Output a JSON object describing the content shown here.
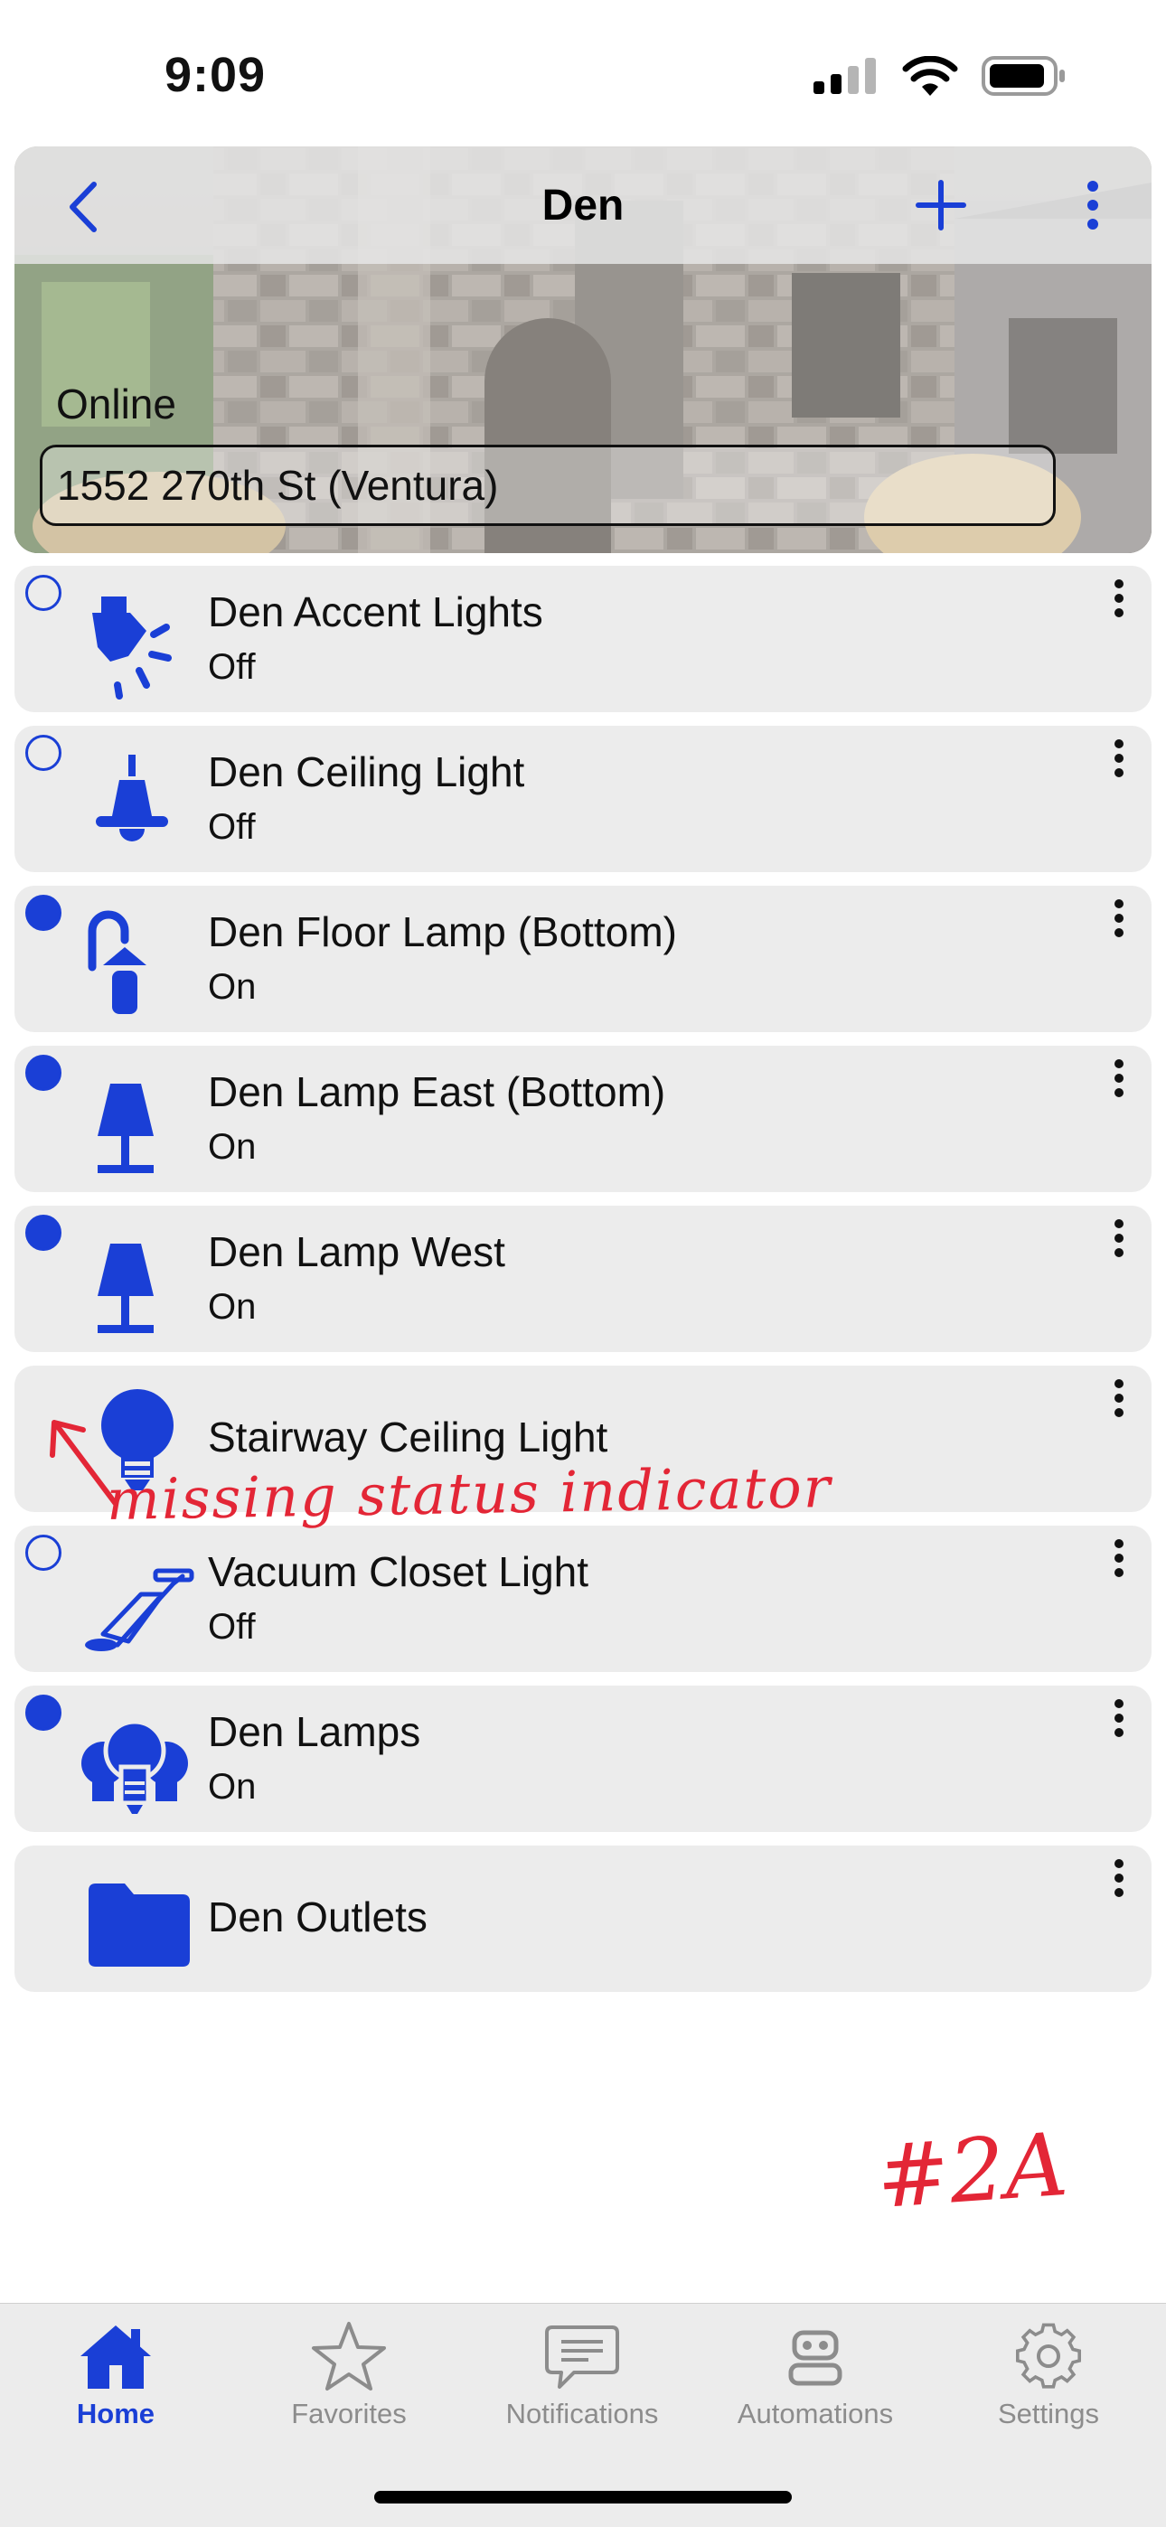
{
  "status_bar": {
    "time": "9:09"
  },
  "header": {
    "title": "Den",
    "status": "Online",
    "location": "1552 270th St (Ventura)"
  },
  "devices": [
    {
      "name": "Den Accent Lights",
      "state": "Off",
      "indicator": "off",
      "icon": "spotlight-icon"
    },
    {
      "name": "Den Ceiling Light",
      "state": "Off",
      "indicator": "off",
      "icon": "ceiling-light-icon"
    },
    {
      "name": "Den Floor Lamp (Bottom)",
      "state": "On",
      "indicator": "on",
      "icon": "floor-lamp-icon"
    },
    {
      "name": "Den Lamp East (Bottom)",
      "state": "On",
      "indicator": "on",
      "icon": "table-lamp-icon"
    },
    {
      "name": "Den Lamp West",
      "state": "On",
      "indicator": "on",
      "icon": "table-lamp-icon"
    },
    {
      "name": "Stairway Ceiling Light",
      "state": "",
      "indicator": "missing",
      "icon": "lightbulb-icon"
    },
    {
      "name": "Vacuum Closet Light",
      "state": "Off",
      "indicator": "off",
      "icon": "vacuum-icon"
    },
    {
      "name": "Den Lamps",
      "state": "On",
      "indicator": "on",
      "icon": "lightbulb-group-icon"
    },
    {
      "name": "Den Outlets",
      "state": "",
      "indicator": "none",
      "icon": "folder-icon"
    }
  ],
  "annotations": {
    "note": "missing status indicator",
    "id": "#2A"
  },
  "tabs": [
    {
      "label": "Home",
      "icon": "house-icon",
      "active": true
    },
    {
      "label": "Favorites",
      "icon": "star-icon",
      "active": false
    },
    {
      "label": "Notifications",
      "icon": "chat-bubble-icon",
      "active": false
    },
    {
      "label": "Automations",
      "icon": "robot-icon",
      "active": false
    },
    {
      "label": "Settings",
      "icon": "gear-icon",
      "active": false
    }
  ],
  "colors": {
    "accent": "#1a3fd6",
    "row_background": "#ececec",
    "annotation": "#e32636",
    "inactive_tab": "#8c8c8c"
  }
}
